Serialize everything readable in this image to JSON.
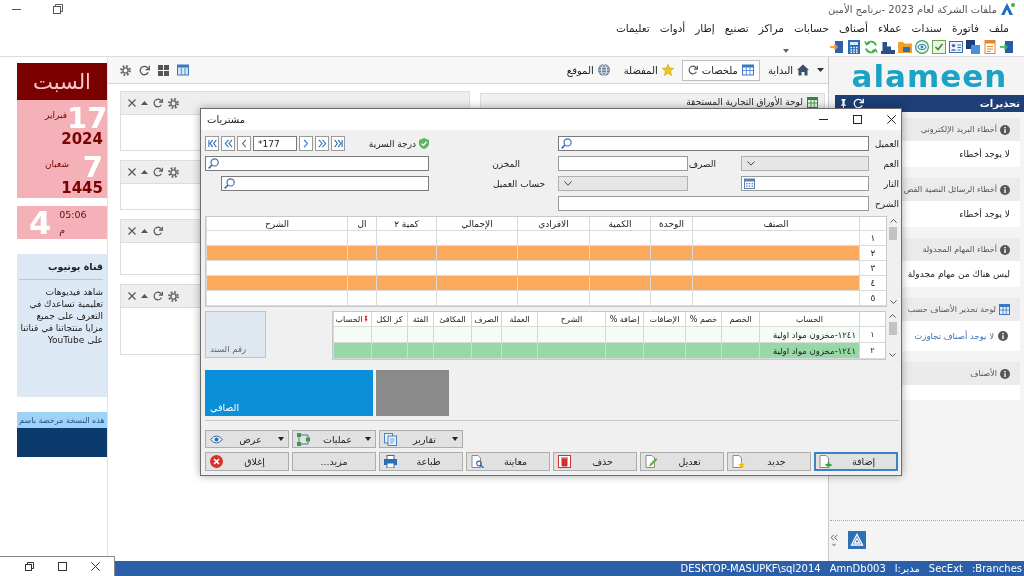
{
  "window": {
    "title": "ملفات الشركة لعام 2023 -برنامج الأمين"
  },
  "menu": [
    "ملف",
    "فاتورة",
    "سندات",
    "عملاء",
    "أصناف",
    "حسابات",
    "مراكز",
    "تصنيع",
    "إطار",
    "أدوات",
    "تعليمات"
  ],
  "tabs": [
    {
      "label": "البداية",
      "selected": false
    },
    {
      "label": "ملخصات",
      "selected": true
    },
    {
      "label": "المفضلة",
      "selected": false
    },
    {
      "label": "الموقع",
      "selected": false
    }
  ],
  "dashboard": {
    "featured_widget": {
      "title": "لوحة الأوراق التجارية المستحقة"
    },
    "side_widgets": [
      {
        "configurable": true
      },
      {
        "configurable": true
      },
      {
        "configurable": false
      },
      {
        "configurable": true
      }
    ]
  },
  "calendar": {
    "weekday": "السبت",
    "gregorian": {
      "month": "فبراير",
      "day": "17",
      "year": "2024"
    },
    "hijri": {
      "month": "شعبان",
      "day": "7",
      "year": "1445"
    },
    "clock": {
      "hour": "4",
      "time": "05:06",
      "period": "م"
    }
  },
  "youtube_card": {
    "title": "قناة يوتيوب",
    "text": "شاهد فيديوهات تعليمية تساعدك في التعرف على جميع مزايا منتجاتنا في قناتنا على YouTube"
  },
  "license": {
    "label": "هذه النسخة مرخصة باسم"
  },
  "sidebar": {
    "logo": "alameen",
    "title": "تحذيرات",
    "cards": [
      {
        "kind": "status",
        "title": "أخطاء البريد الإلكتروني",
        "body": "لا يوجد أخطاء"
      },
      {
        "kind": "status",
        "title": "أخطاء الرسائل النصية القص",
        "body": "لا يوجد أخطاء"
      },
      {
        "kind": "status",
        "title": "أخطاء المهام المجدولة",
        "body": "ليس هناك من مهام مجدولة"
      },
      {
        "kind": "board",
        "title": "لوحة تحذير الأصناف حسب",
        "body": "لا يوجد أصناف تجاوزت"
      },
      {
        "kind": "status",
        "title": "الأصناف"
      }
    ]
  },
  "dialog": {
    "title": "مشتريات",
    "record_number": "*177",
    "secrecy_label": "درجة السرية",
    "fields": [
      {
        "label": "العميل",
        "kind": "search"
      },
      {
        "label": "العم",
        "kind": "combo"
      },
      {
        "label": "الصرف",
        "kind": "text"
      },
      {
        "label": "المخزن",
        "kind": "search"
      },
      {
        "label": "التار",
        "kind": "date"
      },
      {
        "kind": "combo"
      },
      {
        "label": "حساب العميل",
        "kind": "search"
      },
      {
        "label": "الشرح",
        "kind": "text"
      }
    ],
    "items_grid": {
      "columns": [
        {
          "label": "الصنف"
        },
        {
          "label": "الوحدة"
        },
        {
          "label": "الكمية"
        },
        {
          "label": "الافرادي"
        },
        {
          "label": "الإجمالي"
        },
        {
          "label": "كمية ٢"
        },
        {
          "label": "ال"
        },
        {
          "label": "الشرح"
        }
      ],
      "rows": [
        {
          "number": "١",
          "highlighted": false
        },
        {
          "number": "٢",
          "highlighted": true
        },
        {
          "number": "٣",
          "highlighted": false
        },
        {
          "number": "٤",
          "highlighted": true
        },
        {
          "number": "٥",
          "highlighted": false
        }
      ]
    },
    "accounts_grid": {
      "columns": [
        {
          "label": "الحساب",
          "pinned": false
        },
        {
          "label": "الخصم",
          "pinned": false
        },
        {
          "label": "خصم %",
          "pinned": false
        },
        {
          "label": "الإضافات",
          "pinned": false
        },
        {
          "label": "إضافة %",
          "pinned": false
        },
        {
          "label": "الشرح",
          "pinned": false
        },
        {
          "label": "العملة",
          "pinned": false
        },
        {
          "label": "الصرف",
          "pinned": false
        },
        {
          "label": "المكافئ",
          "pinned": false
        },
        {
          "label": "الفئة",
          "pinned": false
        },
        {
          "label": "كز الكل",
          "pinned": false
        },
        {
          "label": "الحساب",
          "pinned": true
        }
      ],
      "rows": [
        {
          "number": "١",
          "account": "١٢٤١-مخزون مواد اولية",
          "selected": false
        },
        {
          "number": "٢",
          "account": "١٢٤١-مخزون مواد اولية",
          "selected": true
        }
      ]
    },
    "document_number": {
      "label": "رقم السند"
    },
    "totals": {
      "net_label": "الصافي"
    },
    "menu_buttons": [
      {
        "label": "تقارير"
      },
      {
        "label": "عمليات"
      },
      {
        "label": "عرض"
      }
    ],
    "buttons": [
      {
        "label": "إضافة",
        "default": true
      },
      {
        "label": "جديد",
        "default": false
      },
      {
        "label": "تعديل",
        "default": false
      },
      {
        "label": "حذف",
        "default": false
      },
      {
        "label": "معاينة",
        "default": false
      },
      {
        "label": "طباعة",
        "default": false
      },
      {
        "label": "مزيد...",
        "default": false
      },
      {
        "label": "إغلاق",
        "default": false
      }
    ]
  },
  "status_bar": [
    ":Branches",
    "SecExt",
    "مدير:ا",
    "AmnDb003",
    "DESKTOP-MASUPKF\\sql2014"
  ]
}
